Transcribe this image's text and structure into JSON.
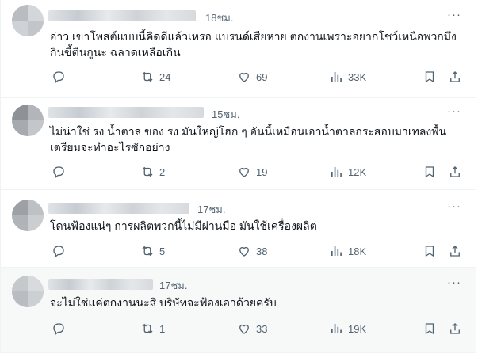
{
  "posts": [
    {
      "time": "18ชม.",
      "lines": [
        "อ่าว เขาโพสต์แบบนี้คิดดีแล้วเหรอ แบรนด์เสียหาย ตกงานเพราะอยากโชว์เหนือพวกมึง",
        "กินขี้ตีนกูนะ ฉลาดเหลือเกิน"
      ],
      "more": "···",
      "reposts": "24",
      "likes": "69",
      "views": "33K"
    },
    {
      "time": "15ชม.",
      "lines": [
        "ไม่น่าใช่ รง น้ำตาล ของ รง มันใหญ่โฮก ๆ อันนี้เหมือนเอาน้ำตาลกระสอบมาเทลงพื้น",
        "เตรียมจะทำอะไรซักอย่าง"
      ],
      "more": "···",
      "reposts": "2",
      "likes": "19",
      "views": "12K"
    },
    {
      "time": "17ชม.",
      "lines": [
        "โดนฟ้องแน่ๆ การผลิตพวกนี้ไม่มีผ่านมือ มันใช้เครื่องผลิต"
      ],
      "more": "···",
      "reposts": "5",
      "likes": "38",
      "views": "18K"
    },
    {
      "time": "17ชม.",
      "lines": [
        "จะไม่ใช่แค่ตกงานนะสิ บริษัทจะฟ้องเอาด้วยครับ"
      ],
      "more": "···",
      "reposts": "1",
      "likes": "33",
      "views": "19K"
    }
  ],
  "icons": {
    "reply": "reply-icon",
    "repost": "repost-icon",
    "like": "like-icon",
    "views": "views-icon",
    "bookmark": "bookmark-icon",
    "share": "share-icon",
    "more": "more-icon"
  },
  "colors": {
    "text": "#0f1419",
    "muted": "#536471",
    "border": "#eff3f4",
    "highlight": "#f7f9f9"
  }
}
